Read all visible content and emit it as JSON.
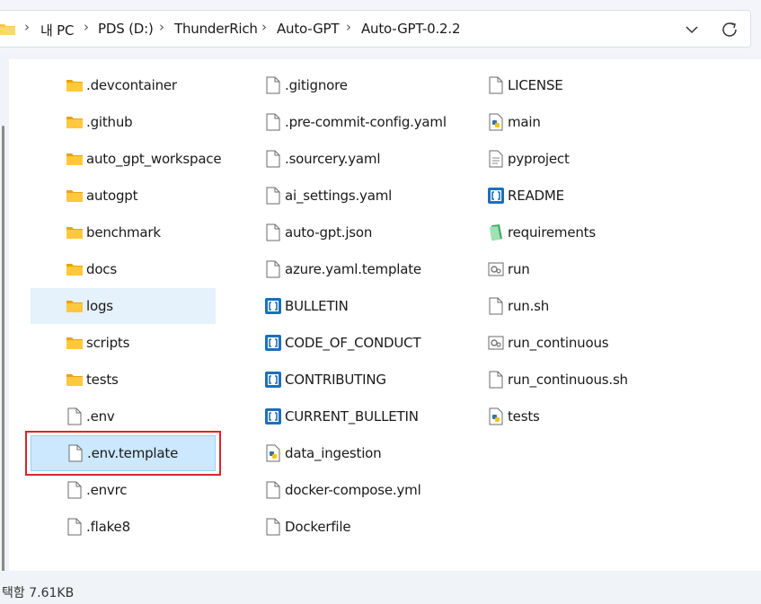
{
  "breadcrumb": {
    "items": [
      "내 PC",
      "PDS (D:)",
      "ThunderRich",
      "Auto-GPT",
      "Auto-GPT-0.2.2"
    ]
  },
  "icons": {
    "folder": "folder-icon",
    "file": "blank-file-icon",
    "python": "python-file-icon",
    "markdown": "markdown-file-icon",
    "toml": "text-file-icon",
    "requirements": "requirements-file-icon",
    "batch": "batch-file-icon"
  },
  "colors": {
    "folder": "#ffc83d",
    "selection_bg": "#cce8ff",
    "selection_border": "#99d1ff",
    "hover_bg": "#e5f1fb",
    "annotation_red": "#d9252b",
    "markdown_blue": "#1e6fb8"
  },
  "files": {
    "col1": [
      {
        "name": ".devcontainer",
        "type": "folder"
      },
      {
        "name": ".github",
        "type": "folder"
      },
      {
        "name": "auto_gpt_workspace",
        "type": "folder"
      },
      {
        "name": "autogpt",
        "type": "folder"
      },
      {
        "name": "benchmark",
        "type": "folder"
      },
      {
        "name": "docs",
        "type": "folder"
      },
      {
        "name": "logs",
        "type": "folder"
      },
      {
        "name": "scripts",
        "type": "folder"
      },
      {
        "name": "tests",
        "type": "folder"
      },
      {
        "name": ".env",
        "type": "file"
      },
      {
        "name": ".env.template",
        "type": "file"
      },
      {
        "name": ".envrc",
        "type": "file"
      },
      {
        "name": ".flake8",
        "type": "file"
      }
    ],
    "col2": [
      {
        "name": ".gitignore",
        "type": "file"
      },
      {
        "name": ".pre-commit-config.yaml",
        "type": "file"
      },
      {
        "name": ".sourcery.yaml",
        "type": "file"
      },
      {
        "name": "ai_settings.yaml",
        "type": "file"
      },
      {
        "name": "auto-gpt.json",
        "type": "file"
      },
      {
        "name": "azure.yaml.template",
        "type": "file"
      },
      {
        "name": "BULLETIN",
        "type": "markdown"
      },
      {
        "name": "CODE_OF_CONDUCT",
        "type": "markdown"
      },
      {
        "name": "CONTRIBUTING",
        "type": "markdown"
      },
      {
        "name": "CURRENT_BULLETIN",
        "type": "markdown"
      },
      {
        "name": "data_ingestion",
        "type": "python"
      },
      {
        "name": "docker-compose.yml",
        "type": "file"
      },
      {
        "name": "Dockerfile",
        "type": "file"
      }
    ],
    "col3": [
      {
        "name": "LICENSE",
        "type": "file"
      },
      {
        "name": "main",
        "type": "python"
      },
      {
        "name": "pyproject",
        "type": "toml"
      },
      {
        "name": "README",
        "type": "markdown"
      },
      {
        "name": "requirements",
        "type": "requirements"
      },
      {
        "name": "run",
        "type": "batch"
      },
      {
        "name": "run.sh",
        "type": "file"
      },
      {
        "name": "run_continuous",
        "type": "batch"
      },
      {
        "name": "run_continuous.sh",
        "type": "file"
      },
      {
        "name": "tests",
        "type": "python"
      }
    ]
  },
  "status": {
    "text": "택함 7.61KB"
  }
}
